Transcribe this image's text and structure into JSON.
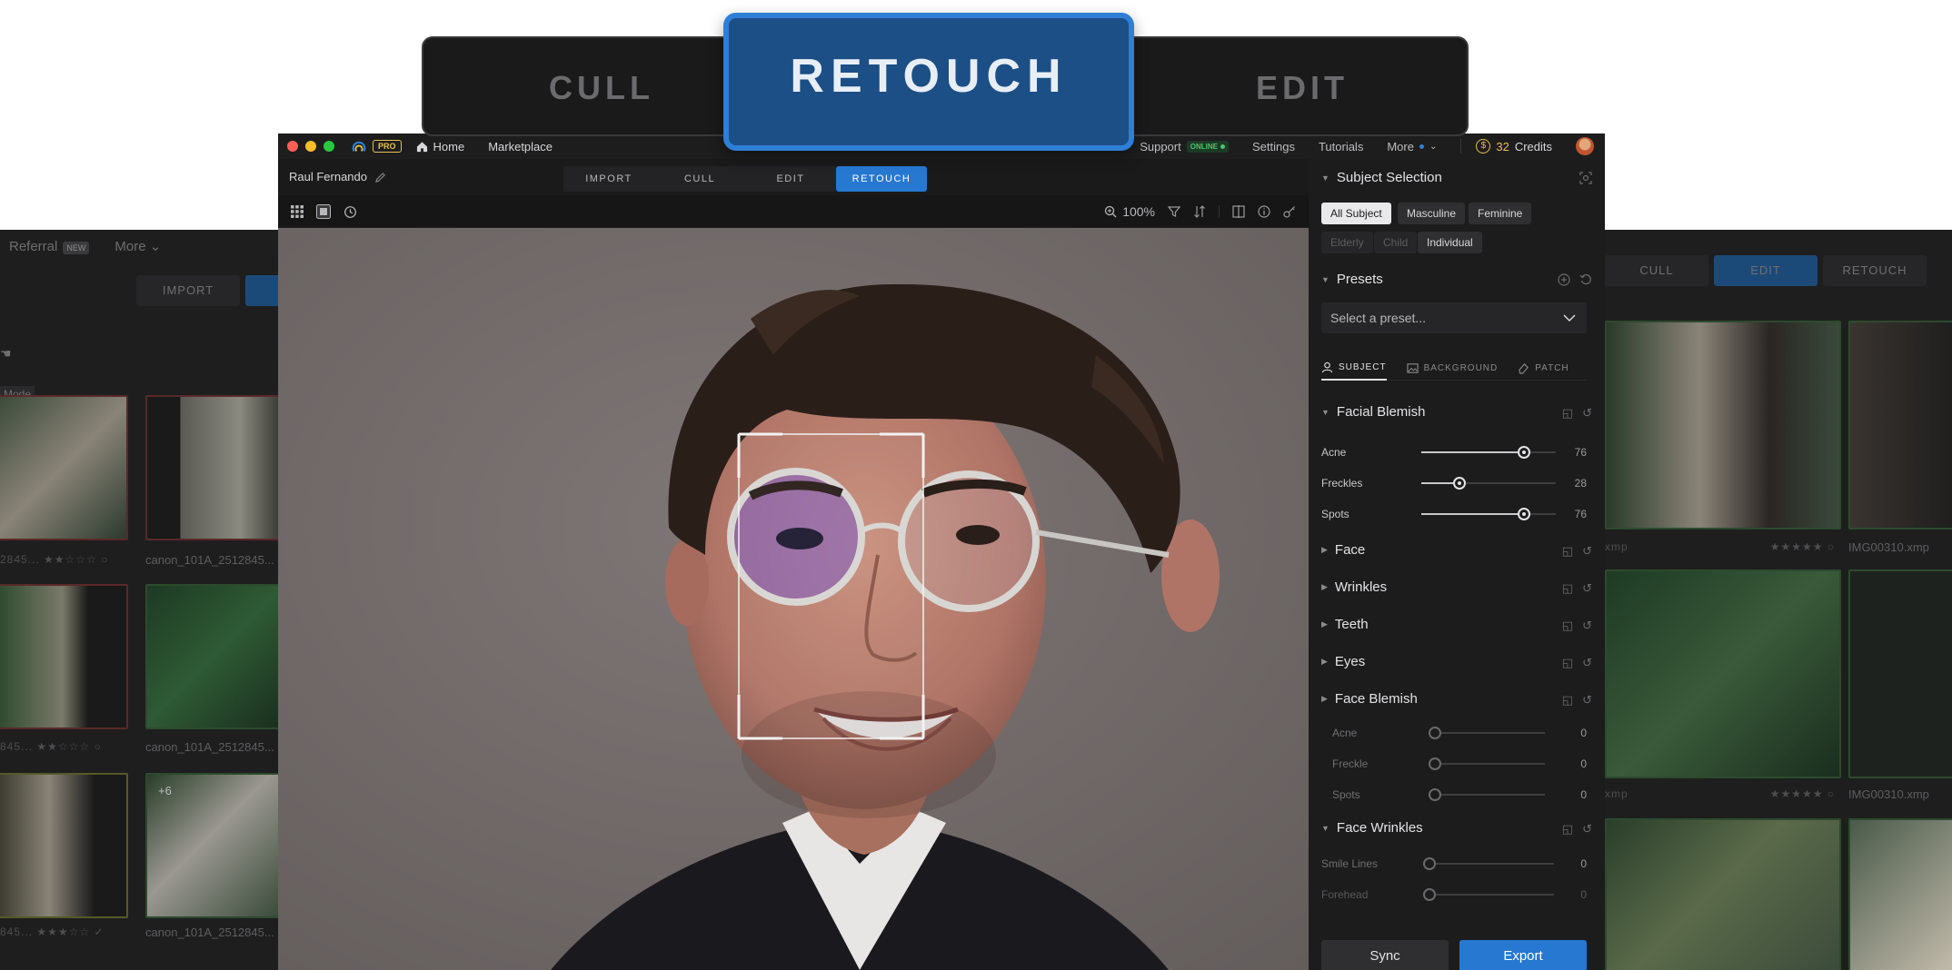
{
  "mode_switcher": {
    "left": "CULL",
    "active": "RETOUCH",
    "right": "EDIT"
  },
  "titlebar": {
    "pro_badge": "PRO",
    "home": "Home",
    "marketplace": "Marketplace",
    "support": "Support",
    "online": "ONLINE",
    "settings": "Settings",
    "tutorials": "Tutorials",
    "more": "More",
    "credits_count": "32",
    "credits_label": "Credits",
    "coin_symbol": "$"
  },
  "subbar": {
    "user_name": "Raul Fernando",
    "tabs": [
      "IMPORT",
      "CULL",
      "EDIT",
      "RETOUCH"
    ]
  },
  "toolbar": {
    "zoom": "100%"
  },
  "panel": {
    "subject_selection": {
      "title": "Subject Selection",
      "chips": [
        "All Subject",
        "Masculine",
        "Feminine",
        "Elderly",
        "Child",
        "Individual"
      ]
    },
    "presets": {
      "title": "Presets",
      "placeholder": "Select a preset..."
    },
    "subtabs": [
      "SUBJECT",
      "BACKGROUND",
      "PATCH"
    ],
    "facial_blemish": {
      "title": "Facial Blemish",
      "sliders": [
        {
          "label": "Acne",
          "value": "76"
        },
        {
          "label": "Freckles",
          "value": "28"
        },
        {
          "label": "Spots",
          "value": "76"
        }
      ]
    },
    "collapsed_sections": [
      "Face",
      "Wrinkles",
      "Teeth",
      "Eyes"
    ],
    "face_blemish": {
      "title": "Face Blemish",
      "sliders": [
        {
          "label": "Acne",
          "value": "0"
        },
        {
          "label": "Freckle",
          "value": "0"
        },
        {
          "label": "Spots",
          "value": "0"
        }
      ]
    },
    "face_wrinkles": {
      "title": "Face Wrinkles",
      "sliders": [
        {
          "label": "Smile Lines",
          "value": "0"
        },
        {
          "label": "Forehead",
          "value": "0"
        }
      ]
    },
    "sync_label": "Sync",
    "export_label": "Export"
  },
  "background_left": {
    "referral": "Referral",
    "new_badge": "NEW",
    "more": "More",
    "import_tab": "IMPORT",
    "mode_label": "Mode",
    "captions": [
      "canon_101A_2512845...",
      "canon_101A_2512845...",
      "canon_101A_2512845..."
    ],
    "truncated": [
      "2845...",
      "845...",
      "845..."
    ],
    "plus_badge": "+6"
  },
  "background_right": {
    "tabs": [
      "CULL",
      "EDIT",
      "RETOUCH"
    ],
    "captions": [
      "IMG00310.xmp",
      "IMG00310.xmp"
    ],
    "truncated": [
      "xmp",
      "xmp"
    ]
  },
  "colors": {
    "accent": "#2678d1",
    "switcher_active": "#1b4f86",
    "pro": "#e6c24a",
    "online": "#4cc46a"
  }
}
